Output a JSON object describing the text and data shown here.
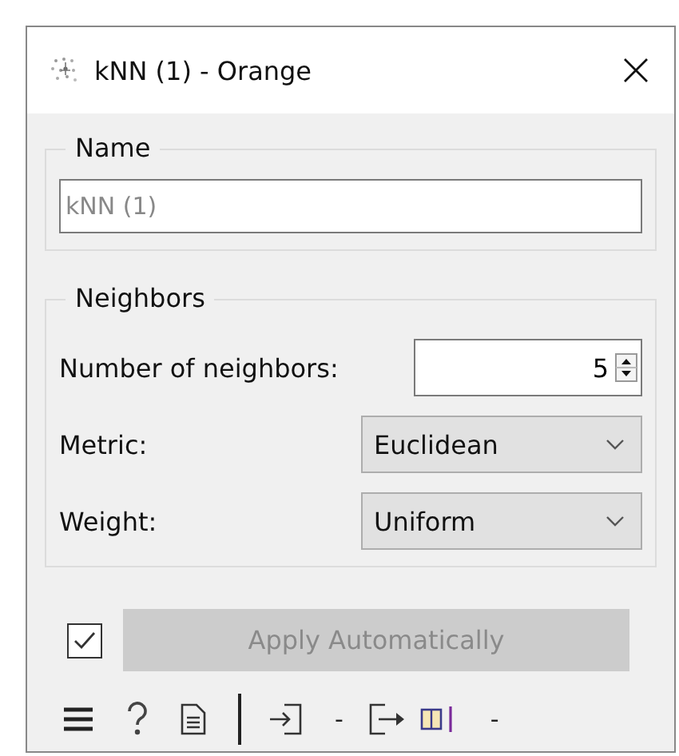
{
  "window": {
    "title": "kNN (1) - Orange"
  },
  "name_group": {
    "title": "Name",
    "field": {
      "placeholder": "kNN (1)"
    }
  },
  "neighbors_group": {
    "title": "Neighbors",
    "rows": [
      {
        "kind": "spin",
        "label": "Number of neighbors:",
        "value": "5"
      },
      {
        "kind": "select",
        "label": "Metric:",
        "value": "Euclidean"
      },
      {
        "kind": "select",
        "label": "Weight:",
        "value": "Uniform"
      }
    ]
  },
  "auto_apply": {
    "checked": true,
    "label": "Apply Automatically",
    "disabled": true
  },
  "status_bar": {
    "input_summary": "-",
    "output_summary": "-"
  }
}
